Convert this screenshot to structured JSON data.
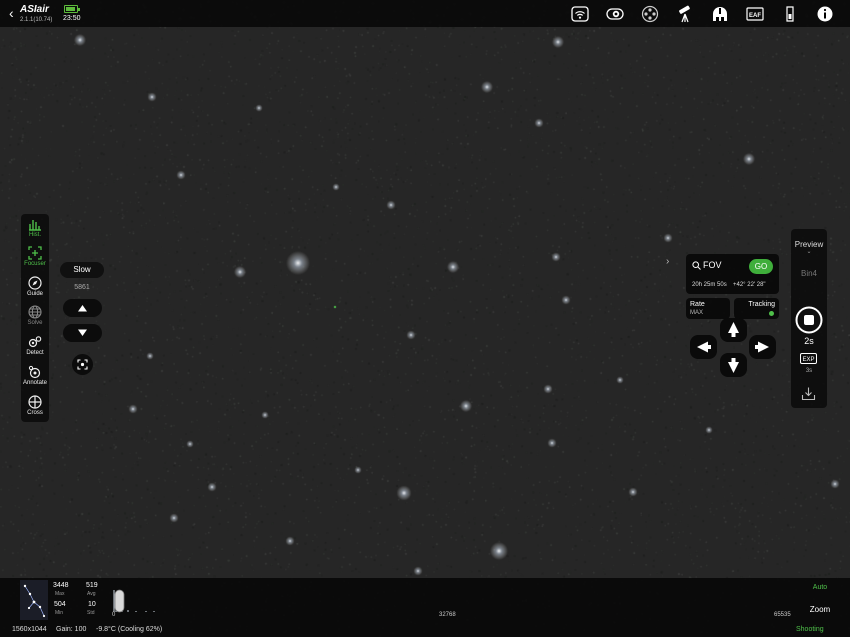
{
  "app": {
    "back_icon": "chevron-left-icon",
    "logo": "ASIair",
    "version": "2.1.1(10.74)",
    "clock": "23:50",
    "battery_color": "#5dbb3c"
  },
  "topbar_icons": [
    "wifi-icon",
    "camera-icon",
    "filter-wheel-icon",
    "telescope-mount-icon",
    "observatory-icon",
    "eaf-focuser-icon",
    "storage-icon",
    "info-icon"
  ],
  "left_tools": [
    {
      "label": "Hist.",
      "icon": "histogram-icon",
      "state": "active"
    },
    {
      "label": "Focuser",
      "icon": "focuser-icon",
      "state": "active"
    },
    {
      "label": "Guide",
      "icon": "guide-icon",
      "state": "normal"
    },
    {
      "label": "Solve",
      "icon": "globe-icon",
      "state": "dim"
    },
    {
      "label": "Detect",
      "icon": "detect-icon",
      "state": "normal"
    },
    {
      "label": "Annotate",
      "icon": "annotate-icon",
      "state": "normal"
    },
    {
      "label": "Cross",
      "icon": "crosshair-icon",
      "state": "normal"
    }
  ],
  "focuser": {
    "speed": "Slow",
    "position": "5861",
    "up_icon": "triangle-up-icon",
    "down_icon": "triangle-down-icon",
    "auto_icon": "auto-focus-icon"
  },
  "goto": {
    "search_value": "FOV",
    "go_label": "GO",
    "ra": "20h 25m 50s",
    "dec": "+42° 22' 28\"",
    "rate_label": "Rate",
    "rate_value": "MAX",
    "tracking_label": "Tracking",
    "tracking_color": "#4fc04a"
  },
  "capture": {
    "mode": "Preview",
    "bin": "Bin4",
    "exposure": "2s",
    "exp_badge": "EXP",
    "exp_secondary": "3s"
  },
  "stats": {
    "max_value": "3448",
    "max_label": "Max",
    "avg_value": "519",
    "avg_label": "Avg",
    "min_value": "504",
    "min_label": "Min",
    "std_value": "10",
    "std_label": "Std"
  },
  "histogram": {
    "ticks": [
      "0",
      "32768",
      "65535"
    ],
    "auto_label": "Auto",
    "zoom_label": "Zoom"
  },
  "status": {
    "resolution": "1560x1044",
    "gain": "Gain: 100",
    "temperature": "-9.8°C (Cooling 62%)",
    "state": "Shooting"
  },
  "colors": {
    "accent": "#4fc04a",
    "go_button": "#3fae3b"
  }
}
